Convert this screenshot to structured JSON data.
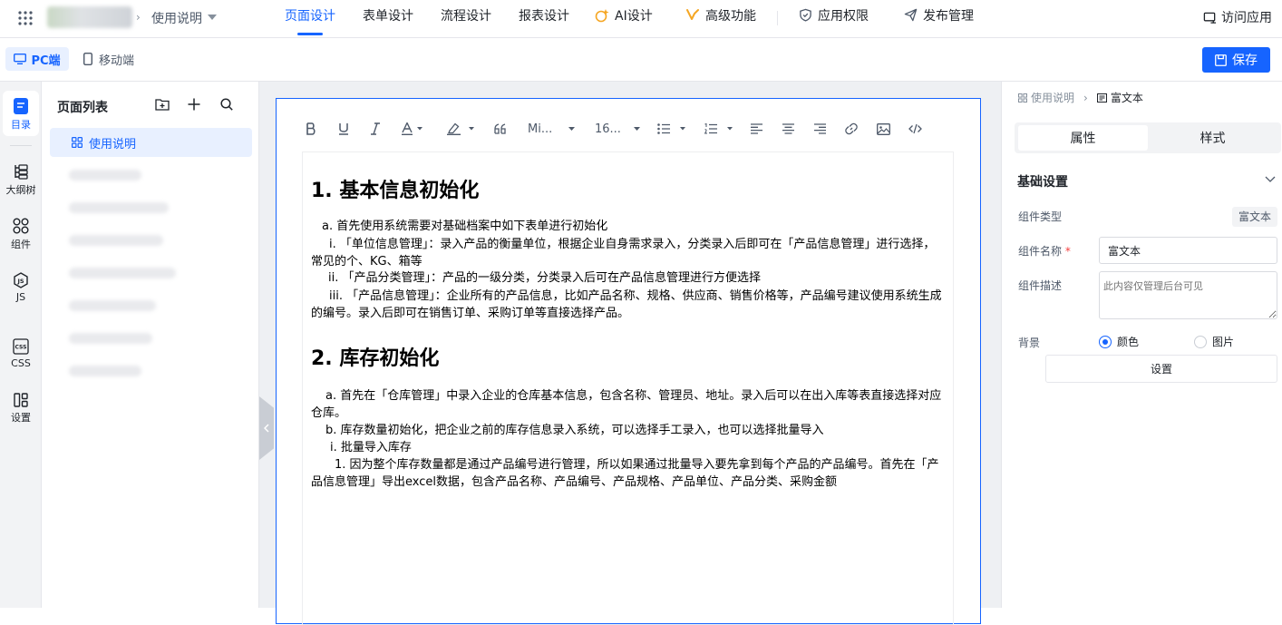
{
  "header": {
    "breadcrumb_app": "使用说明",
    "tabs": [
      "页面设计",
      "表单设计",
      "流程设计",
      "报表设计",
      "AI设计",
      "高级功能",
      "应用权限",
      "发布管理"
    ],
    "visit_app": "访问应用"
  },
  "toolbar": {
    "pc_label": "PC端",
    "mobile_label": "移动端",
    "save_label": "保存"
  },
  "rail": {
    "items": [
      "目录",
      "大纲树",
      "组件",
      "JS",
      "CSS",
      "设置"
    ]
  },
  "pagelist": {
    "title": "页面列表",
    "active_item": "使用说明"
  },
  "editor": {
    "font_family": "Mi...",
    "font_size": "16...",
    "content": {
      "h1": "1. 基本信息初始化",
      "p1": "a. 首先使用系统需要对基础档案中如下表单进行初始化",
      "p2": "i. 「单位信息管理」：录入产品的衡量单位，根据企业自身需求录入，分类录入后即可在「产品信息管理」进行选择，常见的个、KG、箱等",
      "p3": "ii. 「产品分类管理」：产品的一级分类，分类录入后可在产品信息管理进行方便选择",
      "p4": "iii. 「产品信息管理」：企业所有的产品信息，比如产品名称、规格、供应商、销售价格等，产品编号建议使用系统生成的编号。录入后即可在销售订单、采购订单等直接选择产品。",
      "h2": "2. 库存初始化",
      "p5": "a. 首先在「仓库管理」中录入企业的仓库基本信息，包含名称、管理员、地址。录入后可以在出入库等表直接选择对应仓库。",
      "p6": "b. 库存数量初始化，把企业之前的库存信息录入系统，可以选择手工录入，也可以选择批量导入",
      "p7": "i. 批量导入库存",
      "p8": "1. 因为整个库存数量都是通过产品编号进行管理，所以如果通过批量导入要先拿到每个产品的产品编号。首先在「产品信息管理」导出excel数据，包含产品名称、产品编号、产品规格、产品单位、产品分类、采购金额"
    }
  },
  "props": {
    "breadcrumb_parent": "使用说明",
    "breadcrumb_current": "富文本",
    "tab_attr": "属性",
    "tab_style": "样式",
    "section_title": "基础设置",
    "component_type_label": "组件类型",
    "component_type_value": "富文本",
    "component_name_label": "组件名称",
    "required_mark": "*",
    "component_name_value": "富文本",
    "component_desc_label": "组件描述",
    "component_desc_placeholder": "此内容仅管理后台可见",
    "background_label": "背景",
    "bg_option_color": "颜色",
    "bg_option_image": "图片",
    "settings_button": "设置"
  },
  "colors": {
    "accent": "#1664ff",
    "rail_bg": "#f2f3f5",
    "canvas_bg": "#eef0f3"
  }
}
